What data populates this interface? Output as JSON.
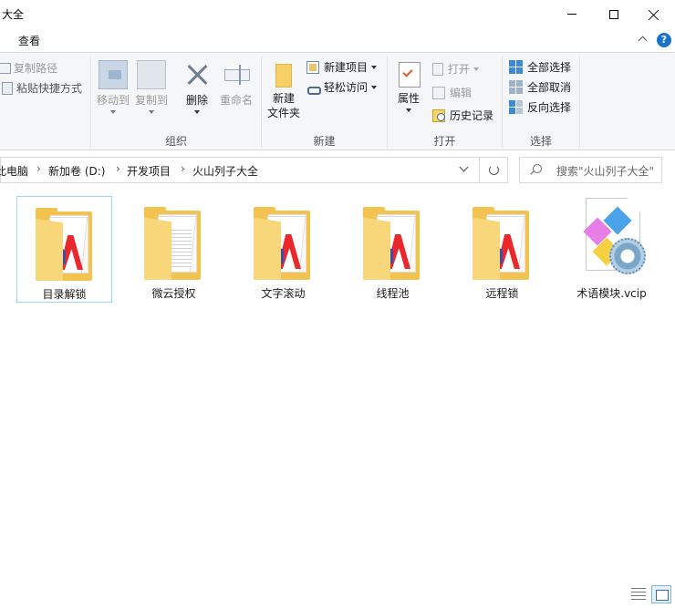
{
  "window": {
    "title": "大全",
    "minimize_label": "",
    "maximize_label": "",
    "close_label": ""
  },
  "ribbon_tabs": {
    "view_tab": "查看",
    "help_label": "?"
  },
  "ribbon": {
    "clipboard": {
      "copy_path": "复制路径",
      "paste_shortcut": "粘贴快捷方式"
    },
    "organize": {
      "move_to": "移动到",
      "copy_to": "复制到",
      "delete": "删除",
      "rename": "重命名",
      "group_label": "组织"
    },
    "new": {
      "new_folder_line1": "新建",
      "new_folder_line2": "文件夹",
      "new_item": "新建项目",
      "easy_access": "轻松访问",
      "group_label": "新建"
    },
    "open": {
      "properties": "属性",
      "open": "打开",
      "edit": "编辑",
      "history": "历史记录",
      "group_label": "打开"
    },
    "select": {
      "select_all": "全部选择",
      "select_none": "全部取消",
      "invert_selection": "反向选择",
      "group_label": "选择"
    }
  },
  "address": {
    "crumbs": [
      "此电脑",
      "新加卷 (D:)",
      "开发项目",
      "火山列子大全"
    ],
    "separator": "›"
  },
  "search": {
    "placeholder": "搜索\"火山列子大全\""
  },
  "items": [
    {
      "name": "目录解锁",
      "type": "folder",
      "icon": "folder-logo-icon",
      "selected": true
    },
    {
      "name": "微云授权",
      "type": "folder",
      "icon": "folder-document-icon",
      "selected": false
    },
    {
      "name": "文字滚动",
      "type": "folder",
      "icon": "folder-logo-icon",
      "selected": false
    },
    {
      "name": "线程池",
      "type": "folder",
      "icon": "folder-logo-icon",
      "selected": false
    },
    {
      "name": "远程锁",
      "type": "folder",
      "icon": "folder-logo-icon",
      "selected": false
    },
    {
      "name": "术语模块.vcip",
      "type": "file",
      "icon": "vcip-file-icon",
      "selected": false
    }
  ],
  "colors": {
    "accent": "#1a73c9",
    "folder": "#f2c34f",
    "logo_red": "#e8282b",
    "logo_blue": "#3d4fb3",
    "selection_border": "#99d1ff"
  }
}
